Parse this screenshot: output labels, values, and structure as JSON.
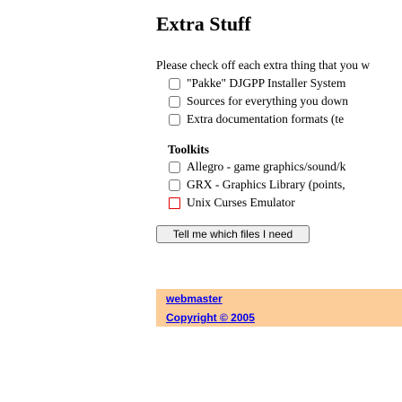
{
  "page": {
    "title": "Extra Stuff",
    "intro": "Please check off each extra thing that you w",
    "extras": [
      {
        "label": "\"Pakke\" DJGPP Installer System",
        "checked": false
      },
      {
        "label": "Sources for everything you down",
        "checked": false
      },
      {
        "label": "Extra documentation formats (te",
        "checked": false
      }
    ],
    "toolkits_heading": "Toolkits",
    "toolkits": [
      {
        "label": "Allegro - game graphics/sound/k",
        "checked": false
      },
      {
        "label": "GRX - Graphics Library (points,",
        "checked": false
      },
      {
        "label": "Unix Curses Emulator",
        "checked": false,
        "focused": true
      }
    ],
    "submit_label": "Tell me which files I need"
  },
  "footer": {
    "webmaster": "webmaster",
    "copyright": "Copyright © 2005",
    "background": "#fccc99"
  }
}
